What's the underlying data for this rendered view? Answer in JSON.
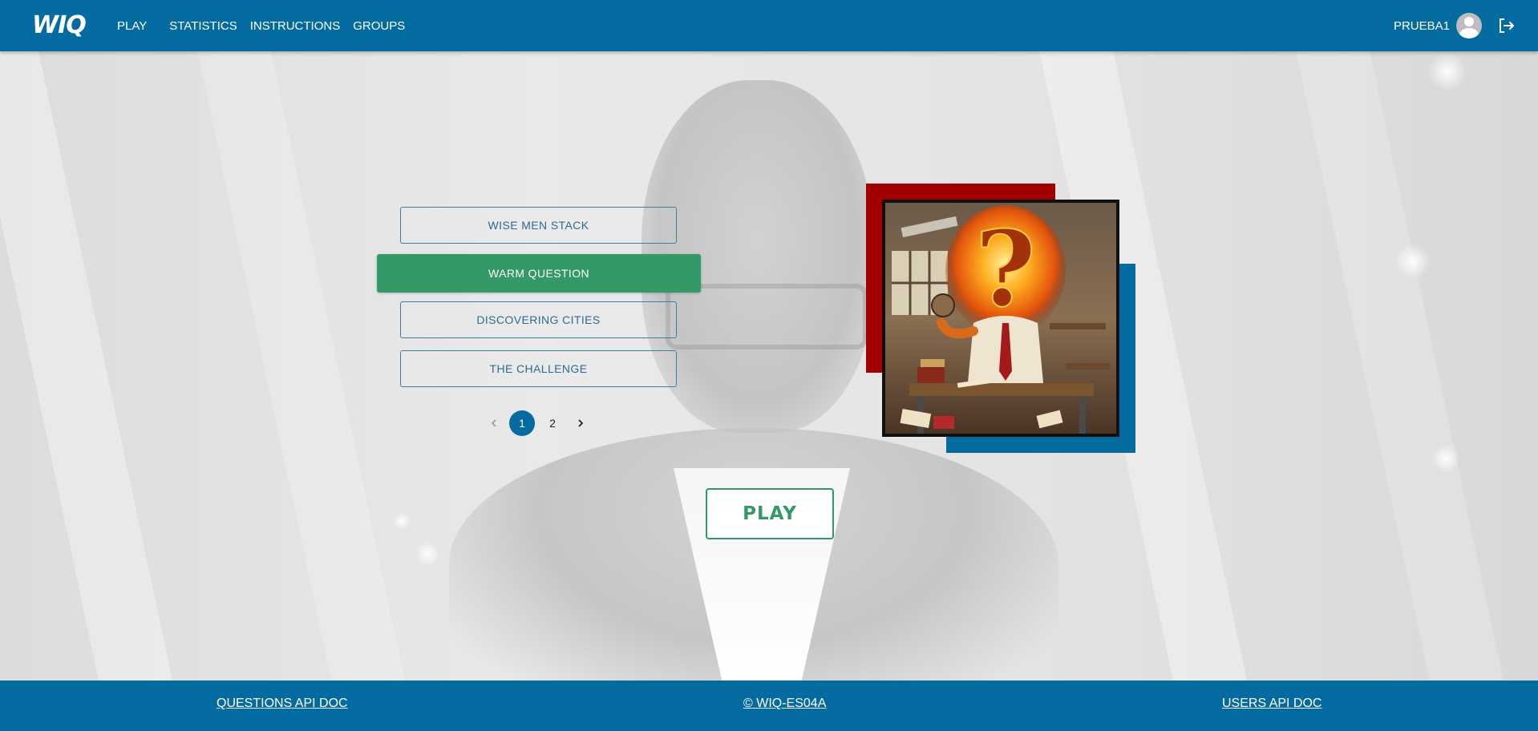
{
  "header": {
    "logo": "WIQ",
    "nav": [
      {
        "label": "PLAY"
      },
      {
        "label": "STATISTICS"
      },
      {
        "label": "INSTRUCTIONS"
      },
      {
        "label": "GROUPS"
      }
    ],
    "username": "PRUEBA1",
    "avatar_icon": "user-avatar-icon",
    "logout_icon": "logout-icon"
  },
  "games": [
    {
      "label": "WISE MEN STACK",
      "selected": false
    },
    {
      "label": "WARM QUESTION",
      "selected": true
    },
    {
      "label": "DISCOVERING CITIES",
      "selected": false
    },
    {
      "label": "THE CHALLENGE",
      "selected": false
    }
  ],
  "pagination": {
    "prev_icon": "chevron-left-icon",
    "pages": [
      "1",
      "2"
    ],
    "current": "1",
    "next_icon": "chevron-right-icon"
  },
  "play_button": {
    "label": "PLAY"
  },
  "game_image": {
    "alt": "Warm Question illustration",
    "glyph": "?"
  },
  "colors": {
    "primary": "#036ba0",
    "accent_green": "#339966",
    "frame_red": "#a30000"
  },
  "footer": {
    "left_link": "QUESTIONS API DOC",
    "center_link": "© WIQ-ES04A",
    "right_link": "USERS API DOC"
  }
}
